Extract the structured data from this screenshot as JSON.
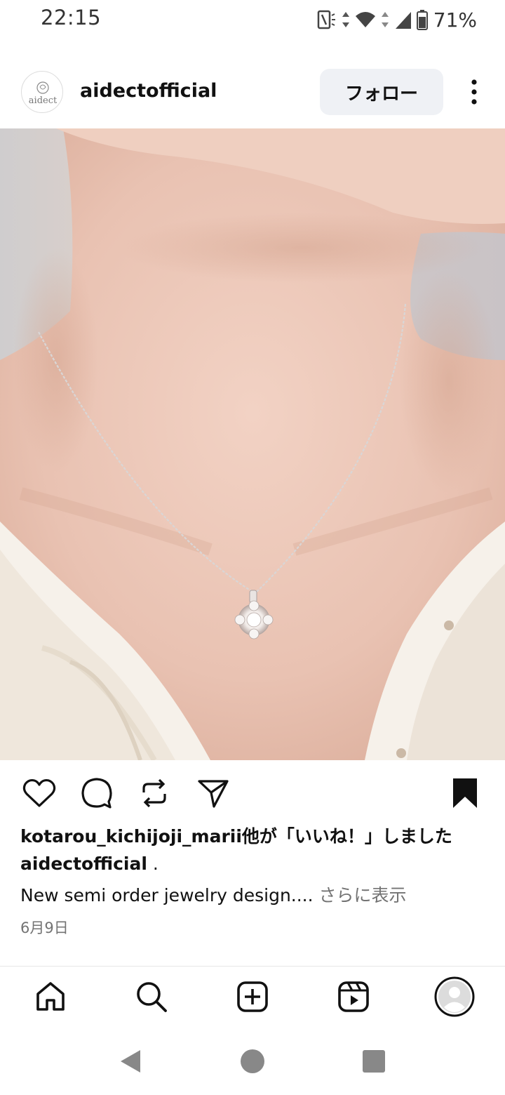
{
  "status_bar": {
    "time": "22:15",
    "battery": "71%",
    "icons": [
      "nfc-icon",
      "data-arrows-icon",
      "wifi-icon",
      "signal-icon",
      "battery-icon"
    ]
  },
  "post": {
    "username": "aidectofficial",
    "avatar_text": "aidect",
    "follow_label": "フォロー",
    "image_description_icon": "necklace-photo",
    "likes_user": "kotarou_kichijoji_marii",
    "likes_suffix": "他が「いいね！」しました",
    "caption_user": "aidectofficial",
    "caption_user_suffix": " .",
    "caption_text": "New semi order jewelry design....",
    "caption_more": " さらに表示",
    "date": "6月9日"
  },
  "actions": [
    "heart-icon",
    "comment-icon",
    "repost-icon",
    "share-icon",
    "bookmark-icon"
  ],
  "bottom_nav": [
    "home-icon",
    "search-icon",
    "create-icon",
    "reels-icon",
    "profile-icon"
  ],
  "system_nav": [
    "back-icon",
    "home-circle-icon",
    "recents-icon"
  ]
}
